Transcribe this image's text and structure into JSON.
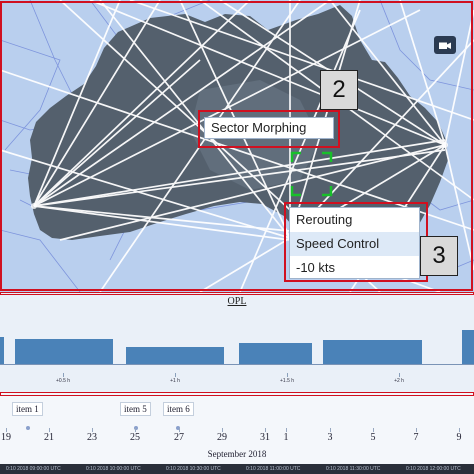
{
  "map": {
    "callout_2": "2",
    "callout_3": "3",
    "sector_popup": {
      "label": "Sector Morphing"
    },
    "action_menu": {
      "items": [
        "Rerouting",
        "Speed Control",
        "-10 kts"
      ],
      "highlighted_index": 1
    },
    "camera_icon": "camera-icon",
    "colors": {
      "land": "#54606d",
      "sea": "#b9cfee",
      "routes": "#ffffff",
      "frame": "#d01020",
      "target": "#18c02a"
    }
  },
  "opl": {
    "title": "OPL",
    "ticks": [
      "+0.5 h",
      "+1 h",
      "+1.5 h",
      "+2 h"
    ],
    "bar_color": "#4a82b8"
  },
  "timeline": {
    "items": [
      "item 1",
      "item 5",
      "item 6"
    ],
    "days": [
      "19",
      "21",
      "23",
      "25",
      "27",
      "29",
      "31",
      "1",
      "3",
      "5",
      "7",
      "9"
    ],
    "month_label": "September 2018",
    "timestamps": [
      "0:10 2018 09:00:00 UTC",
      "0:10 2018 10:00:00 UTC",
      "0:10 2018 10:30:00 UTC",
      "0:10 2018 11:00:00 UTC",
      "0:10 2018 11:30:00 UTC",
      "0:10 2018 12:00:00 UTC"
    ]
  }
}
